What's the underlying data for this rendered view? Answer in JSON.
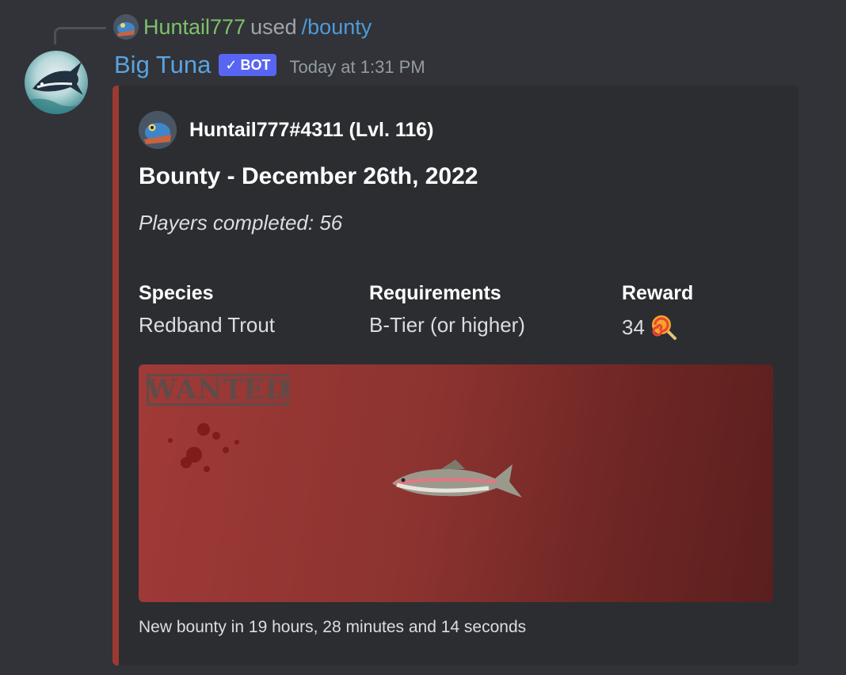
{
  "reply": {
    "user": "Huntail777",
    "used": "used",
    "command": "/bounty"
  },
  "message": {
    "bot_name": "Big Tuna",
    "badge": "BOT",
    "timestamp": "Today at 1:31 PM"
  },
  "embed": {
    "accent_color": "#9b3a33",
    "author": "Huntail777#4311 (Lvl. 116)",
    "title": "Bounty - December 26th, 2022",
    "description": "Players completed: 56",
    "fields": [
      {
        "name": "Species",
        "value": "Redband Trout"
      },
      {
        "name": "Requirements",
        "value": "B-Tier (or higher)"
      },
      {
        "name": "Reward",
        "value": "34",
        "icon": "lollipop-icon"
      }
    ],
    "image": {
      "stamp_text": "WANTED",
      "subject": "fish-icon"
    },
    "footer": "New bounty in 19 hours, 28 minutes and 14 seconds"
  }
}
